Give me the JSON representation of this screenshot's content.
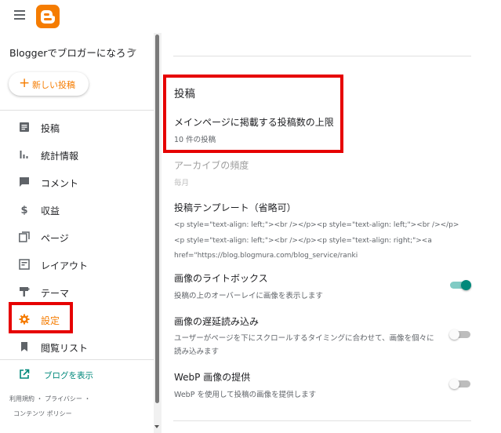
{
  "header": {
    "menu_icon": "menu-icon",
    "logo": "blogger-logo",
    "brand_color": "#f57c00"
  },
  "sidebar": {
    "blog_name": "Bloggerでブロガーになろう",
    "new_post_plus": "+",
    "new_post_label": "新しい投稿",
    "items": [
      {
        "label": "投稿",
        "icon": "posts-icon"
      },
      {
        "label": "統計情報",
        "icon": "stats-icon"
      },
      {
        "label": "コメント",
        "icon": "comment-icon"
      },
      {
        "label": "収益",
        "icon": "earnings-icon"
      },
      {
        "label": "ページ",
        "icon": "pages-icon"
      },
      {
        "label": "レイアウト",
        "icon": "layout-icon"
      },
      {
        "label": "テーマ",
        "icon": "theme-icon"
      },
      {
        "label": "設定",
        "icon": "gear-icon",
        "active": true
      },
      {
        "label": "閲覧リスト",
        "icon": "bookmark-icon"
      }
    ],
    "view_blog": "ブログを表示",
    "footer": {
      "terms": "利用規約",
      "privacy": "プライバシー",
      "content_policy": "コンテンツ ポリシー",
      "sep": "・"
    }
  },
  "main": {
    "section_title": "投稿",
    "settings": [
      {
        "label": "メインページに掲載する投稿数の上限",
        "sub": "10 件の投稿"
      },
      {
        "label": "アーカイブの頻度",
        "sub": "毎月",
        "disabled": true
      },
      {
        "label": "投稿テンプレート（省略可）",
        "code": "<p style=\"text-align: left;\"><br /></p><p style=\"text-align: left;\"><br /></p><p style=\"text-align: left;\"><br /></p><p style=\"text-align: right;\"><a href=\"https://blog.blogmura.com/blog_service/ranki"
      },
      {
        "label": "画像のライトボックス",
        "sub": "投稿の上のオーバーレイに画像を表示します",
        "toggle": true
      },
      {
        "label": "画像の遅延読み込み",
        "sub": "ユーザーがページを下にスクロールするタイミングに合わせて、画像を個々に読み込みます",
        "toggle": false
      },
      {
        "label": "WebP 画像の提供",
        "sub": "WebP を使用して投稿の画像を提供します",
        "toggle": false
      }
    ],
    "accent_on": "#00897b",
    "highlight_color": "#e60000"
  }
}
